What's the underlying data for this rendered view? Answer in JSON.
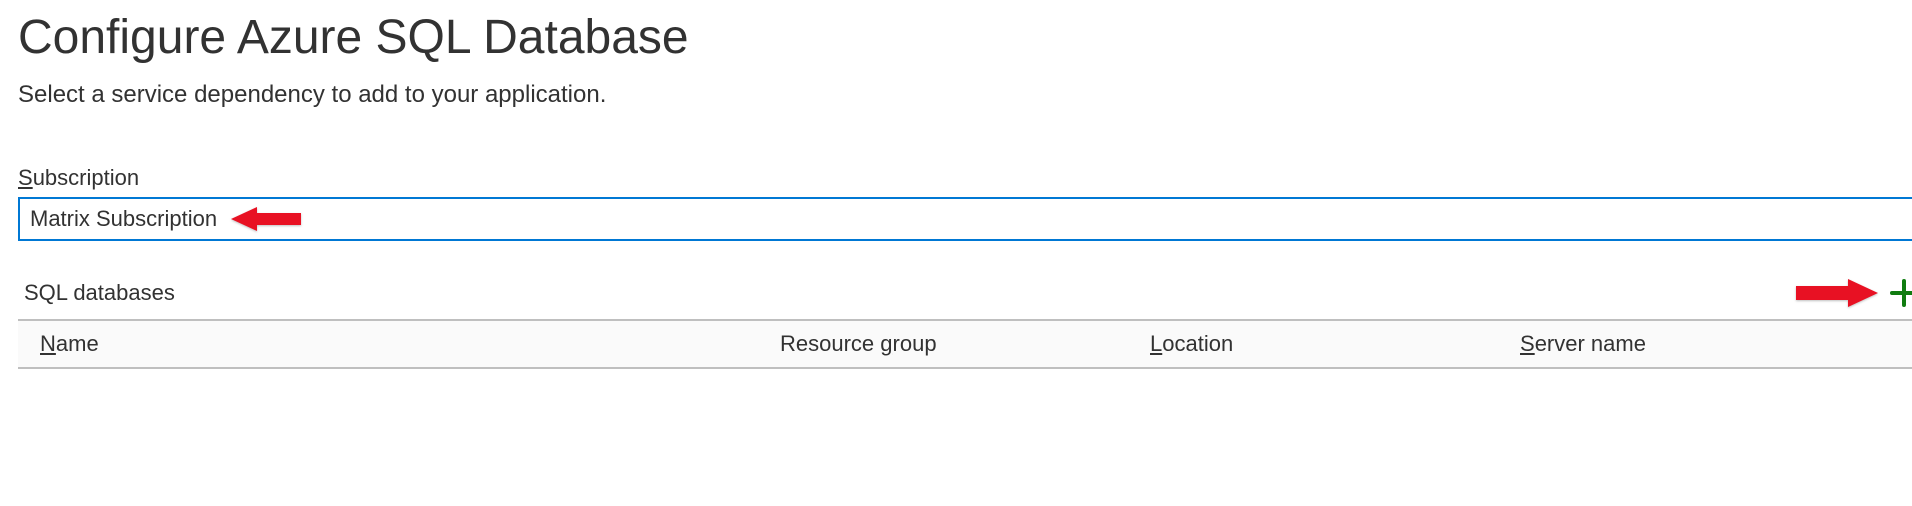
{
  "header": {
    "title": "Configure Azure SQL Database",
    "subtitle": "Select a service dependency to add to your application."
  },
  "subscription": {
    "label": "Subscription",
    "value": "Matrix Subscription"
  },
  "databases": {
    "label": "SQL databases",
    "columns": {
      "name": "Name",
      "resource_group": "Resource group",
      "location": "Location",
      "server_name": "Server name"
    }
  },
  "colors": {
    "accent_blue": "#0078d4",
    "add_green": "#107c10",
    "annotation_red": "#e81123"
  }
}
